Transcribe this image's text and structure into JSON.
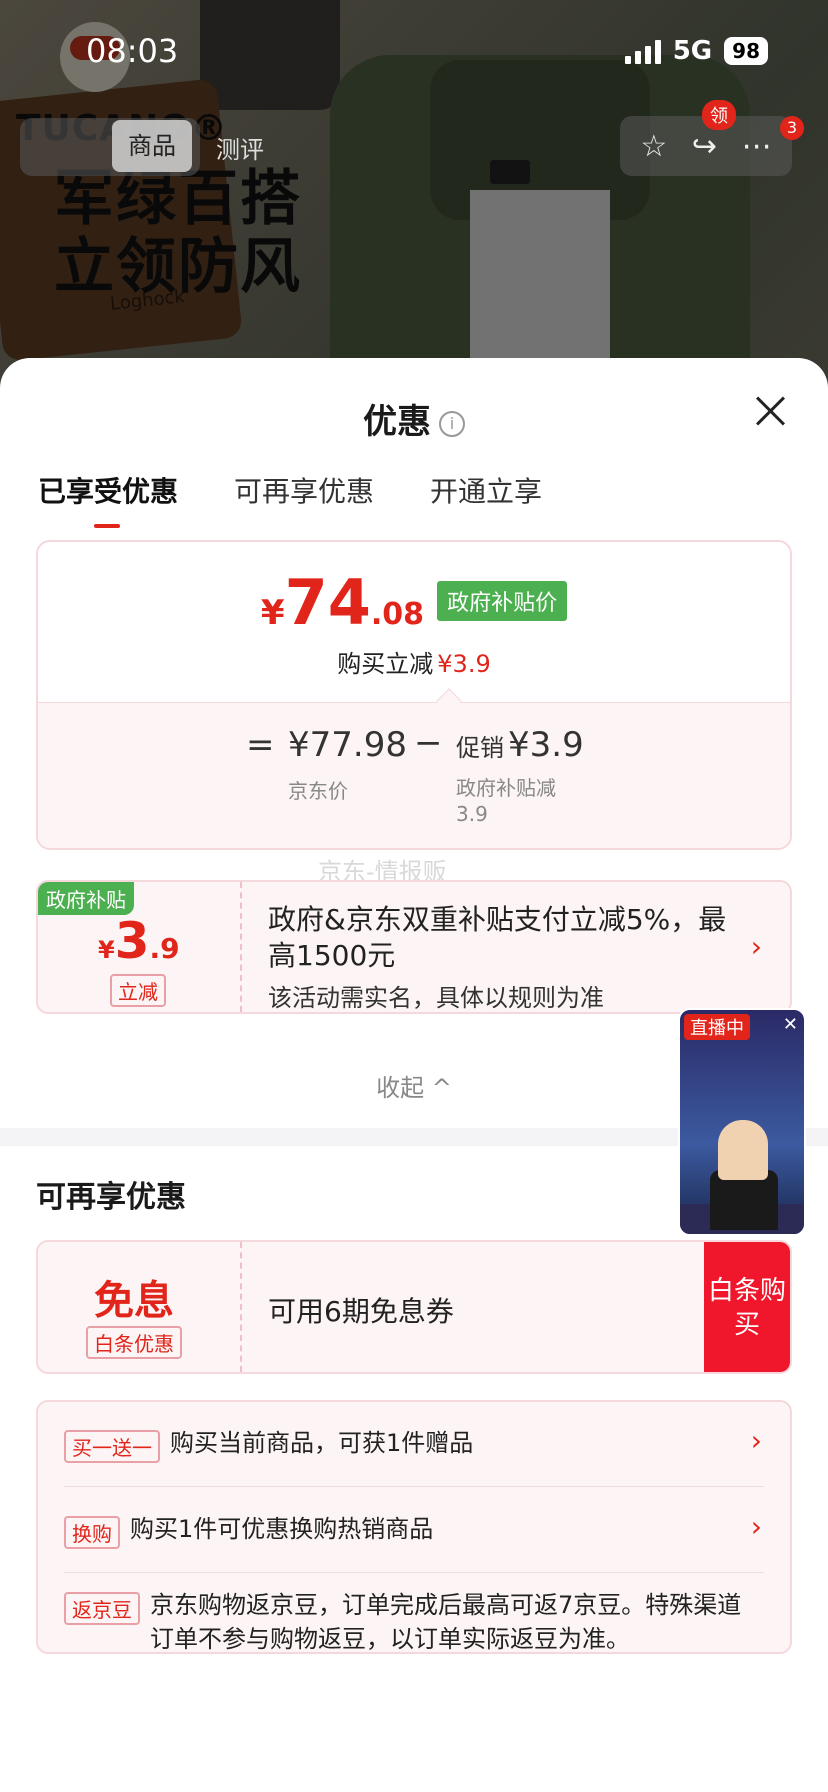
{
  "status_bar": {
    "time": "08:03",
    "network": "5G",
    "battery": "98"
  },
  "background": {
    "brand": "TUCANO®",
    "headline_line1": "军绿百搭",
    "headline_line2": "立领防风",
    "wallet_text": "Loghock"
  },
  "top_nav": {
    "tabs": [
      {
        "label": "商品"
      },
      {
        "label": "测评"
      }
    ],
    "badge_ling": "领",
    "badge_count": "3"
  },
  "sheet": {
    "title": "优惠",
    "tabs": [
      {
        "label": "已享受优惠"
      },
      {
        "label": "可再享优惠"
      },
      {
        "label": "开通立享"
      }
    ],
    "price": {
      "currency": "¥",
      "integer": "74",
      "decimal": ".08",
      "gov_tag": "政府补贴价",
      "save_label": "购买立减",
      "save_amount": "¥3.9",
      "equals": "=",
      "jd_price": "¥77.98",
      "jd_price_caption": "京东价",
      "minus": "−",
      "promo_label": "促销",
      "promo_amount": "¥3.9",
      "promo_caption_line1": "政府补贴减",
      "promo_caption_line2": "3.9"
    },
    "watermark": "京东-情报贩",
    "subsidy_coupon": {
      "tag": "政府补贴",
      "currency": "¥",
      "integer": "3",
      "decimal": ".9",
      "sub": "立减",
      "title": "政府&京东双重补贴支付立减5%，最高1500元",
      "desc": "该活动需实名，具体以规则为准"
    },
    "collapse_label": "收起 ^",
    "section_title": "可再享优惠",
    "interest_free": {
      "big": "免息",
      "sub": "白条优惠",
      "desc": "可用6期免息券",
      "button": "白条购买"
    },
    "offers": [
      {
        "tag": "买一送一",
        "text": "购买当前商品，可获1件赠品"
      },
      {
        "tag": "换购",
        "text": "购买1件可优惠换购热销商品"
      },
      {
        "tag": "返京豆",
        "text": "京东购物返京豆，订单完成后最高可返7京豆。特殊渠道订单不参与购物返豆，以订单实际返豆为准。"
      }
    ],
    "live": {
      "tag": "直播中",
      "close": "✕"
    }
  },
  "colors": {
    "accent": "#e1251b",
    "gov_green": "#4caf50",
    "card_bg": "#fdf5f5",
    "card_border": "#f4d8dc"
  }
}
